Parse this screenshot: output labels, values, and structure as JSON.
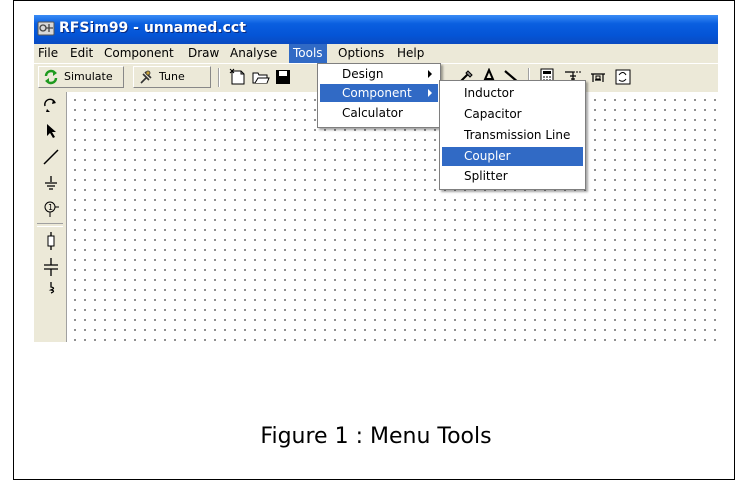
{
  "window": {
    "title": "RFSim99 - unnamed.cct"
  },
  "menubar": {
    "file": "File",
    "edit": "Edit",
    "component": "Component",
    "draw": "Draw",
    "analyse": "Analyse",
    "tools": "Tools",
    "options": "Options",
    "help": "Help"
  },
  "toolbar": {
    "simulate_label": "Simulate",
    "tune_label": "Tune"
  },
  "tools_menu": {
    "design": "Design",
    "component": "Component",
    "calculator": "Calculator"
  },
  "component_submenu": {
    "inductor": "Inductor",
    "capacitor": "Capacitor",
    "transmission_line": "Transmission Line",
    "coupler": "Coupler",
    "splitter": "Splitter"
  },
  "caption": "Figure 1 : Menu Tools",
  "colors": {
    "title_bar": "#0454d6",
    "menu_highlight": "#316ac5",
    "chrome": "#ece9d8"
  }
}
